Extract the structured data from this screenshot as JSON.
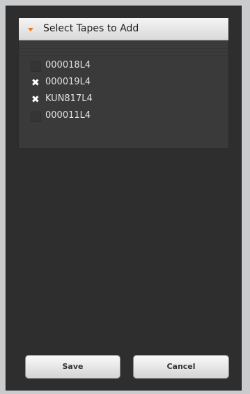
{
  "panel": {
    "title": "Select Tapes to Add",
    "expanded": true,
    "accent_color": "#f07a22",
    "items": [
      {
        "label": "000018L4",
        "checked": false
      },
      {
        "label": "000019L4",
        "checked": true
      },
      {
        "label": "KUN817L4",
        "checked": true
      },
      {
        "label": "000011L4",
        "checked": false
      }
    ]
  },
  "buttons": {
    "save_label": "Save",
    "cancel_label": "Cancel"
  }
}
